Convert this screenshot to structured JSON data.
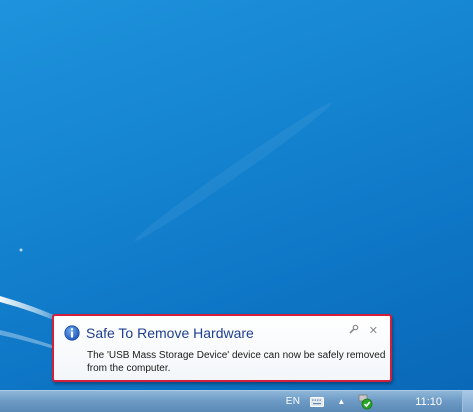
{
  "notification": {
    "title": "Safe To Remove Hardware",
    "message": "The 'USB Mass Storage Device' device can now be safely removed from the computer.",
    "wrench_symbol": "✎",
    "close_symbol": "✕",
    "border_color": "#d21f3c",
    "title_color": "#1e3f8f"
  },
  "taskbar": {
    "language": "EN",
    "overflow_arrow": "▲",
    "clock": "11:10",
    "icons": [
      "keyboard-icon",
      "show-hidden-icons-arrow",
      "safely-remove-hardware-icon"
    ]
  },
  "desktop": {
    "background_color": "#1585d1"
  }
}
